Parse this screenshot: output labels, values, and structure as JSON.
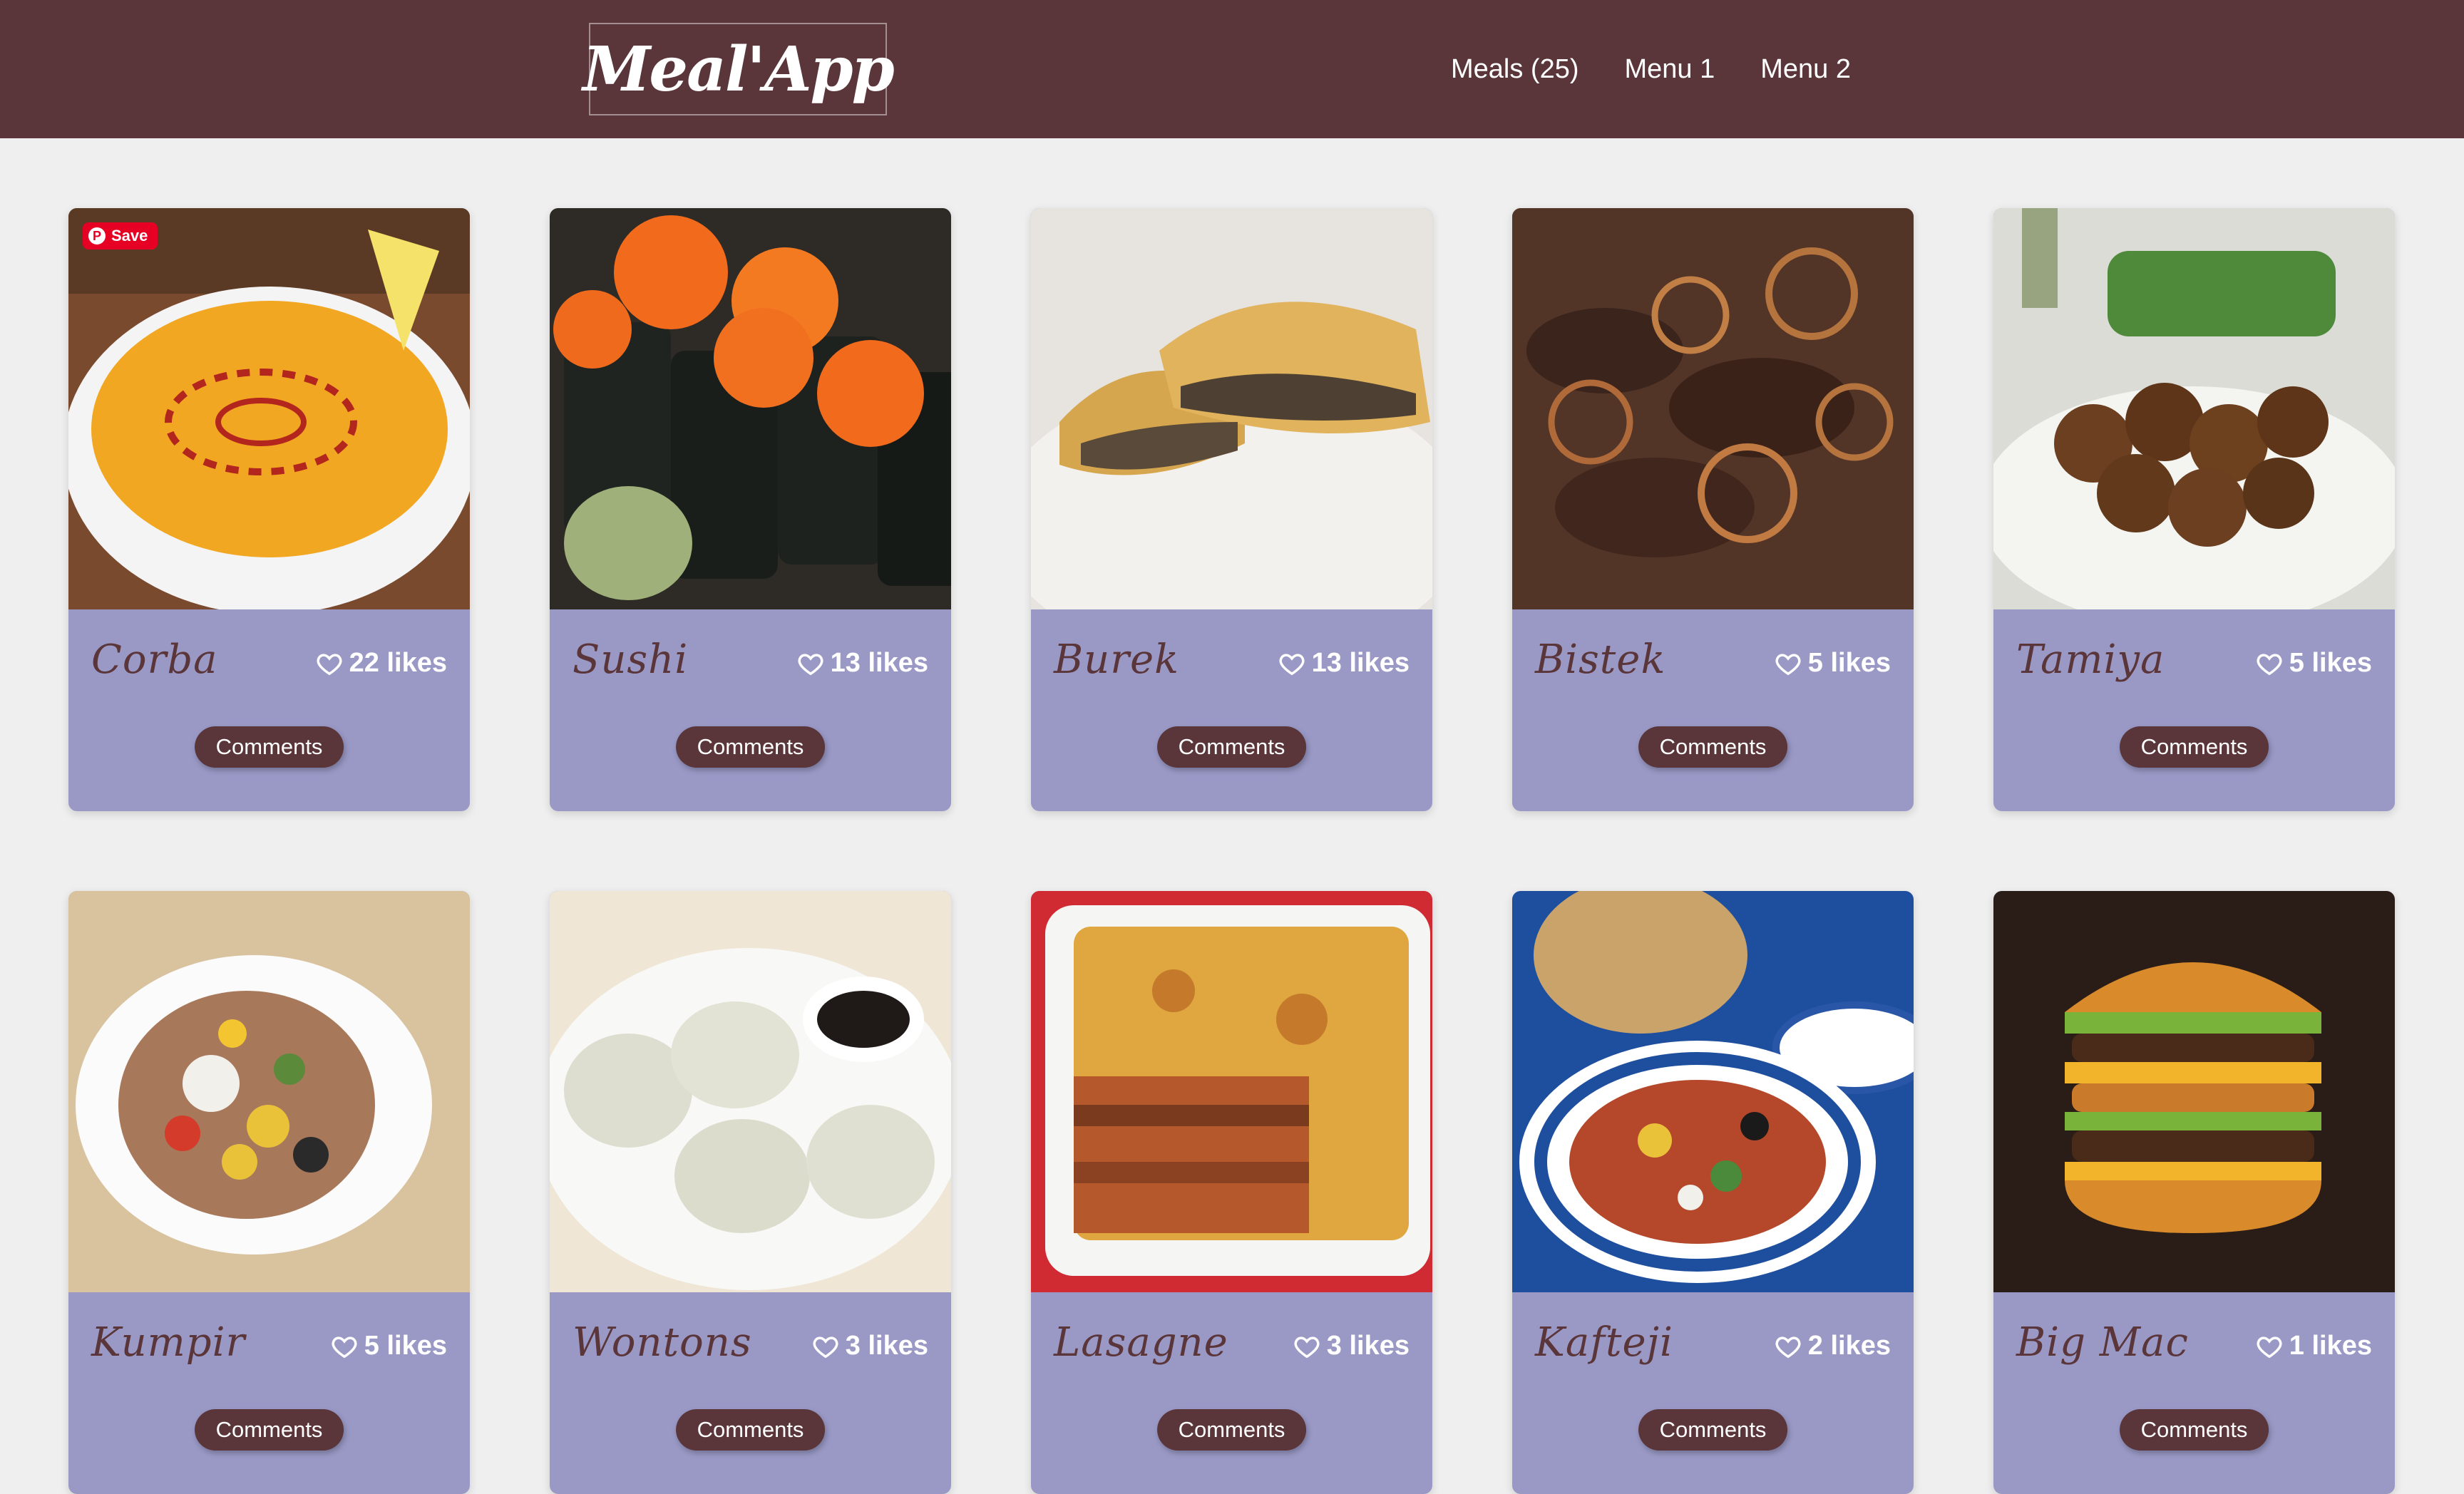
{
  "header": {
    "logo": "Meal'App",
    "nav": [
      {
        "label": "Meals (25)"
      },
      {
        "label": "Menu 1"
      },
      {
        "label": "Menu 2"
      }
    ]
  },
  "pinterest_save": {
    "label": "Save",
    "logo": "P"
  },
  "comments_label": "Comments",
  "meals": [
    {
      "name": "Corba",
      "likes": "22 likes",
      "photo": "lentil-soup"
    },
    {
      "name": "Sushi",
      "likes": "13 likes",
      "photo": "sushi-rolls"
    },
    {
      "name": "Burek",
      "likes": "13 likes",
      "photo": "burek-pastry"
    },
    {
      "name": "Bistek",
      "likes": "5 likes",
      "photo": "steak-onions"
    },
    {
      "name": "Tamiya",
      "likes": "5 likes",
      "photo": "falafel"
    },
    {
      "name": "Kumpir",
      "likes": "5 likes",
      "photo": "stuffed-potato"
    },
    {
      "name": "Wontons",
      "likes": "3 likes",
      "photo": "dumplings"
    },
    {
      "name": "Lasagne",
      "likes": "3 likes",
      "photo": "lasagne"
    },
    {
      "name": "Kafteji",
      "likes": "2 likes",
      "photo": "kafteji-plate"
    },
    {
      "name": "Big Mac",
      "likes": "1 likes",
      "photo": "burger"
    }
  ],
  "colors": {
    "header_bg": "#5a3539",
    "card_bg": "#9a99c6",
    "page_bg": "#efefef",
    "button_bg": "#5a3539"
  }
}
